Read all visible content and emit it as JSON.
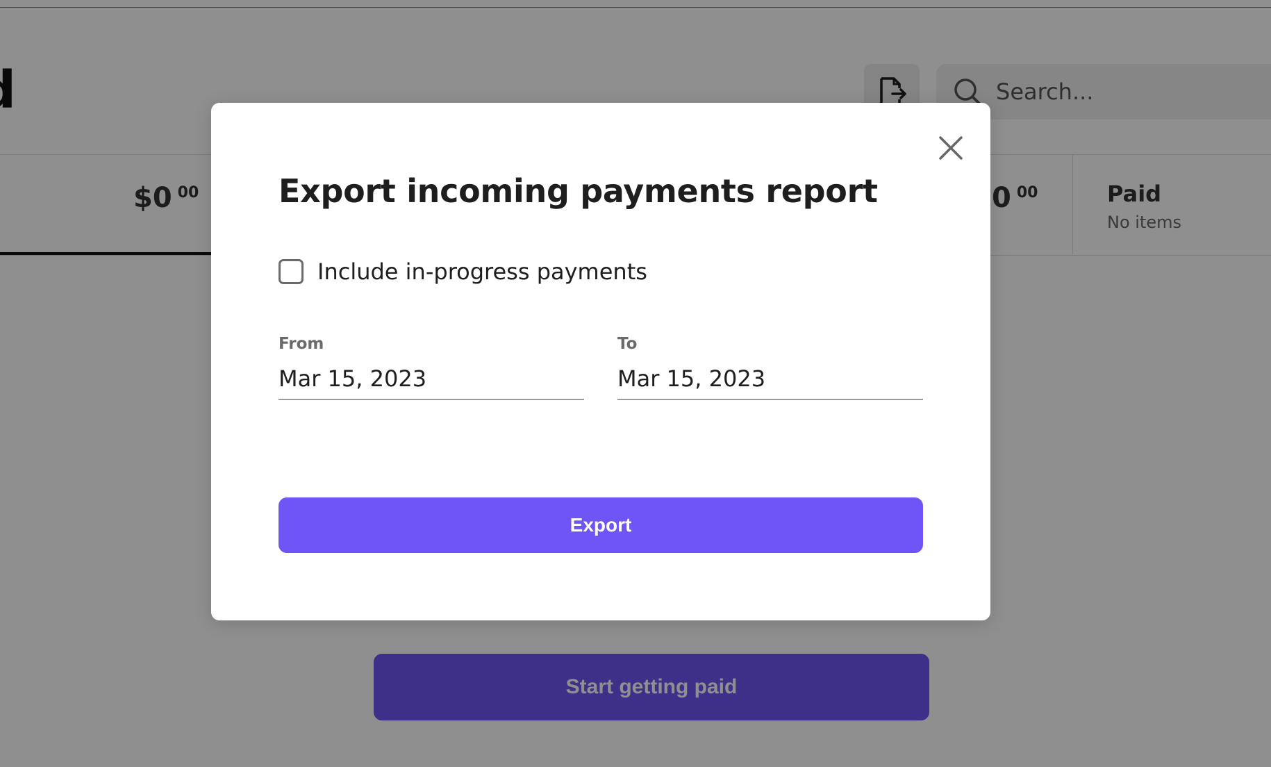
{
  "background": {
    "page_title_fragment": "d",
    "search": {
      "placeholder": "Search..."
    },
    "summary": {
      "amount_left": {
        "whole": "$0",
        "cents": "00"
      },
      "amount_right": {
        "whole": "0",
        "cents": "00"
      },
      "paid": {
        "label": "Paid",
        "status": "No items"
      }
    },
    "start_button_label": "Start getting paid"
  },
  "modal": {
    "title": "Export incoming payments report",
    "include_in_progress": {
      "label": "Include in-progress payments",
      "checked": false
    },
    "from": {
      "label": "From",
      "value": "Mar 15, 2023"
    },
    "to": {
      "label": "To",
      "value": "Mar 15, 2023"
    },
    "export_button_label": "Export"
  },
  "colors": {
    "accent": "#6f55f5",
    "overlay": "rgba(0,0,0,0.44)",
    "text_primary": "#1e1e1e",
    "text_muted": "#6b6b6b"
  },
  "icons": {
    "export_file": "file-export-icon",
    "search": "search-icon",
    "close": "close-icon"
  }
}
